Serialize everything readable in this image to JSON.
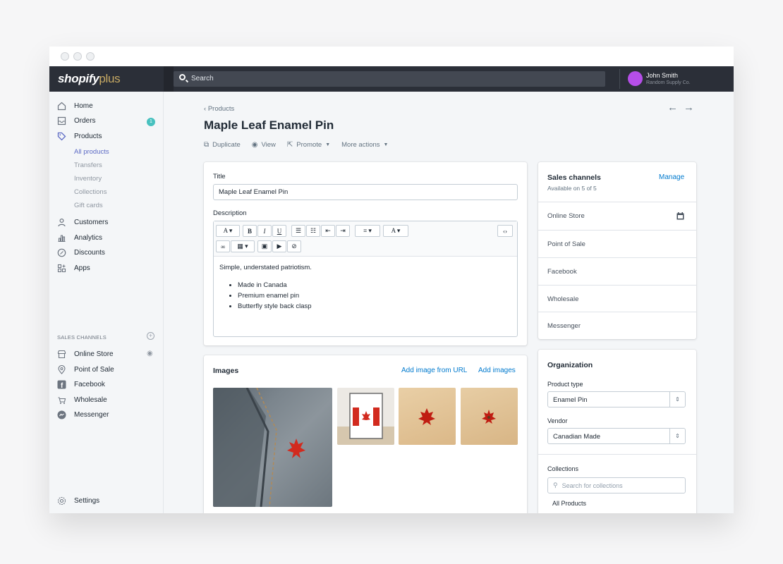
{
  "header": {
    "logo_main": "shopify",
    "logo_plus": "plus",
    "search_placeholder": "Search",
    "user_name": "John Smith",
    "user_store": "Random Supply Co."
  },
  "sidebar": {
    "items": [
      {
        "label": "Home",
        "icon": "home-icon"
      },
      {
        "label": "Orders",
        "icon": "orders-icon",
        "badge": "1"
      },
      {
        "label": "Products",
        "icon": "tag-icon"
      },
      {
        "label": "Customers",
        "icon": "person-icon"
      },
      {
        "label": "Analytics",
        "icon": "bar-chart-icon"
      },
      {
        "label": "Discounts",
        "icon": "discount-icon"
      },
      {
        "label": "Apps",
        "icon": "apps-icon"
      }
    ],
    "product_subitems": [
      "All products",
      "Transfers",
      "Inventory",
      "Collections",
      "Gift cards"
    ],
    "sales_channels_heading": "SALES CHANNELS",
    "channels": [
      {
        "label": "Online Store",
        "icon": "store-icon"
      },
      {
        "label": "Point of Sale",
        "icon": "location-pin-icon"
      },
      {
        "label": "Facebook",
        "icon": "facebook-icon"
      },
      {
        "label": "Wholesale",
        "icon": "wholesale-icon"
      },
      {
        "label": "Messenger",
        "icon": "messenger-icon"
      }
    ],
    "settings": "Settings"
  },
  "page": {
    "breadcrumb": "Products",
    "title": "Maple Leaf Enamel Pin",
    "actions": [
      "Duplicate",
      "View",
      "Promote",
      "More actions"
    ]
  },
  "product_form": {
    "title_label": "Title",
    "title_value": "Maple Leaf Enamel Pin",
    "description_label": "Description",
    "description_intro": "Simple, understated patriotism.",
    "description_bullets": [
      "Made in Canada",
      "Premium enamel pin",
      "Butterfly style back clasp"
    ]
  },
  "images": {
    "heading": "Images",
    "add_from_url": "Add image from URL",
    "add_images": "Add images"
  },
  "sales_channels": {
    "heading": "Sales channels",
    "manage": "Manage",
    "available": "Available on 5 of 5",
    "channels": [
      "Online Store",
      "Point of Sale",
      "Facebook",
      "Wholesale",
      "Messenger"
    ]
  },
  "organization": {
    "heading": "Organization",
    "product_type_label": "Product type",
    "product_type_value": "Enamel Pin",
    "vendor_label": "Vendor",
    "vendor_value": "Canadian Made",
    "collections_label": "Collections",
    "collections_placeholder": "Search for collections",
    "collection_item": "All Products"
  },
  "colors": {
    "accent": "#5c6ac4",
    "link": "#007ace",
    "topbar": "#2b2f38",
    "badge": "#47c1bf",
    "maple_red": "#d22a1e"
  }
}
